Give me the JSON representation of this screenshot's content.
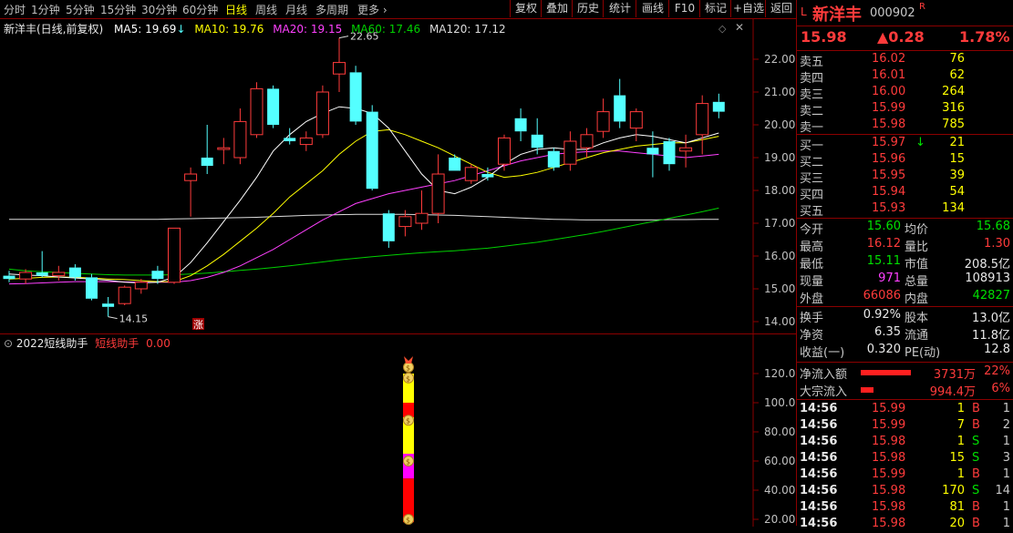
{
  "toolbar": {
    "periods": [
      "分时",
      "1分钟",
      "5分钟",
      "15分钟",
      "30分钟",
      "60分钟",
      "日线",
      "周线",
      "月线",
      "多周期",
      "更多"
    ],
    "active_period": "日线",
    "buttons": [
      "复权",
      "叠加",
      "历史",
      "统计",
      "画线",
      "F10",
      "标记",
      "+自选",
      "返回"
    ]
  },
  "chart_header": {
    "title": "新洋丰(日线,前复权)",
    "ma5": "MA5: 19.69",
    "ma10": "MA10: 19.76",
    "ma20": "MA20: 19.15",
    "ma60": "MA60: 17.46",
    "ma120": "MA120: 17.12"
  },
  "price_axis": [
    "22.00",
    "21.00",
    "20.00",
    "19.00",
    "18.00",
    "17.00",
    "16.00",
    "15.00",
    "14.00"
  ],
  "annotations": {
    "high": "22.65",
    "low": "14.15",
    "limit_up_mark": "涨"
  },
  "indicator": {
    "name": "2022短线助手",
    "label": "短线助手",
    "value": "0.00",
    "axis": [
      "120.00",
      "100.00",
      "80.00",
      "60.00",
      "40.00",
      "20.00"
    ]
  },
  "colors": {
    "up": "#ff3b3b",
    "down": "#54ffff",
    "ma5": "#ffffff",
    "ma10": "#ffff00",
    "ma20": "#ff40ff",
    "ma60": "#00d000",
    "ma120": "#dcdcdc"
  },
  "chart_data": {
    "type": "candlestick",
    "candles": [
      {
        "o": 15.4,
        "h": 15.55,
        "l": 15.2,
        "c": 15.3
      },
      {
        "o": 15.3,
        "h": 15.6,
        "l": 15.15,
        "c": 15.5
      },
      {
        "o": 15.5,
        "h": 16.15,
        "l": 15.35,
        "c": 15.4
      },
      {
        "o": 15.4,
        "h": 15.7,
        "l": 15.25,
        "c": 15.5
      },
      {
        "o": 15.65,
        "h": 15.75,
        "l": 15.25,
        "c": 15.35
      },
      {
        "o": 15.35,
        "h": 15.45,
        "l": 14.65,
        "c": 14.7
      },
      {
        "o": 14.55,
        "h": 14.75,
        "l": 14.15,
        "c": 14.45
      },
      {
        "o": 14.55,
        "h": 15.1,
        "l": 14.5,
        "c": 15.05
      },
      {
        "o": 15.0,
        "h": 15.3,
        "l": 14.85,
        "c": 15.2
      },
      {
        "o": 15.55,
        "h": 15.7,
        "l": 15.15,
        "c": 15.3
      },
      {
        "o": 15.2,
        "h": 16.85,
        "l": 15.15,
        "c": 16.85
      },
      {
        "o": 18.3,
        "h": 18.7,
        "l": 17.2,
        "c": 18.5
      },
      {
        "o": 19.0,
        "h": 20.0,
        "l": 18.5,
        "c": 18.75
      },
      {
        "o": 19.25,
        "h": 19.6,
        "l": 18.8,
        "c": 19.3
      },
      {
        "o": 19.0,
        "h": 20.5,
        "l": 18.8,
        "c": 20.1
      },
      {
        "o": 19.7,
        "h": 21.3,
        "l": 19.6,
        "c": 21.1
      },
      {
        "o": 21.1,
        "h": 21.2,
        "l": 19.9,
        "c": 20.0
      },
      {
        "o": 19.6,
        "h": 19.9,
        "l": 19.4,
        "c": 19.5
      },
      {
        "o": 19.4,
        "h": 19.8,
        "l": 19.2,
        "c": 19.6
      },
      {
        "o": 19.7,
        "h": 21.2,
        "l": 19.6,
        "c": 21.0
      },
      {
        "o": 21.55,
        "h": 22.65,
        "l": 21.0,
        "c": 21.9
      },
      {
        "o": 21.6,
        "h": 21.8,
        "l": 20.0,
        "c": 20.1
      },
      {
        "o": 20.4,
        "h": 20.6,
        "l": 18.0,
        "c": 18.05
      },
      {
        "o": 17.3,
        "h": 17.4,
        "l": 16.25,
        "c": 16.45
      },
      {
        "o": 16.9,
        "h": 17.4,
        "l": 16.6,
        "c": 17.2
      },
      {
        "o": 17.0,
        "h": 18.0,
        "l": 16.8,
        "c": 17.3
      },
      {
        "o": 17.3,
        "h": 19.1,
        "l": 17.0,
        "c": 18.5
      },
      {
        "o": 19.0,
        "h": 19.1,
        "l": 18.6,
        "c": 18.6
      },
      {
        "o": 18.3,
        "h": 18.8,
        "l": 18.2,
        "c": 18.7
      },
      {
        "o": 18.5,
        "h": 18.7,
        "l": 18.3,
        "c": 18.4
      },
      {
        "o": 18.8,
        "h": 19.7,
        "l": 18.6,
        "c": 19.6
      },
      {
        "o": 20.2,
        "h": 20.5,
        "l": 19.5,
        "c": 19.8
      },
      {
        "o": 19.7,
        "h": 20.2,
        "l": 19.1,
        "c": 19.3
      },
      {
        "o": 19.2,
        "h": 19.3,
        "l": 18.6,
        "c": 18.7
      },
      {
        "o": 18.8,
        "h": 19.8,
        "l": 18.6,
        "c": 19.5
      },
      {
        "o": 19.3,
        "h": 19.9,
        "l": 19.0,
        "c": 19.7
      },
      {
        "o": 19.8,
        "h": 20.8,
        "l": 19.6,
        "c": 20.4
      },
      {
        "o": 20.9,
        "h": 21.4,
        "l": 19.9,
        "c": 20.1
      },
      {
        "o": 19.9,
        "h": 20.5,
        "l": 19.5,
        "c": 20.4
      },
      {
        "o": 19.3,
        "h": 19.8,
        "l": 18.4,
        "c": 19.1
      },
      {
        "o": 19.5,
        "h": 19.6,
        "l": 18.6,
        "c": 18.8
      },
      {
        "o": 19.2,
        "h": 19.7,
        "l": 18.7,
        "c": 19.3
      },
      {
        "o": 19.7,
        "h": 20.9,
        "l": 19.1,
        "c": 20.65
      },
      {
        "o": 20.7,
        "h": 20.95,
        "l": 20.2,
        "c": 20.4
      }
    ],
    "ylim": [
      13.75,
      23.1
    ],
    "ma": {
      "ma5": [
        15.45,
        15.42,
        15.4,
        15.36,
        15.33,
        15.3,
        15.26,
        15.2,
        15.18,
        15.2,
        15.35,
        15.8,
        16.4,
        17.05,
        17.7,
        18.4,
        19.2,
        19.7,
        20.1,
        20.35,
        20.55,
        20.5,
        20.35,
        19.9,
        19.2,
        18.5,
        18.0,
        17.9,
        18.1,
        18.4,
        18.8,
        19.1,
        19.25,
        19.3,
        19.25,
        19.25,
        19.45,
        19.6,
        19.7,
        19.65,
        19.55,
        19.45,
        19.6,
        19.75
      ],
      "ma10": [
        15.3,
        15.32,
        15.35,
        15.36,
        15.35,
        15.33,
        15.3,
        15.28,
        15.25,
        15.22,
        15.22,
        15.4,
        15.7,
        16.05,
        16.45,
        16.85,
        17.3,
        17.8,
        18.2,
        18.6,
        19.1,
        19.5,
        19.8,
        19.85,
        19.7,
        19.5,
        19.3,
        19.05,
        18.8,
        18.55,
        18.4,
        18.45,
        18.55,
        18.7,
        18.85,
        19.0,
        19.15,
        19.25,
        19.35,
        19.4,
        19.45,
        19.45,
        19.55,
        19.65
      ],
      "ma20": [
        15.15,
        15.16,
        15.18,
        15.2,
        15.22,
        15.22,
        15.22,
        15.21,
        15.2,
        15.2,
        15.2,
        15.25,
        15.35,
        15.5,
        15.7,
        15.95,
        16.2,
        16.5,
        16.8,
        17.1,
        17.35,
        17.6,
        17.75,
        17.9,
        18.0,
        18.1,
        18.2,
        18.3,
        18.45,
        18.6,
        18.75,
        18.9,
        19.0,
        19.1,
        19.15,
        19.18,
        19.2,
        19.2,
        19.15,
        19.1,
        19.05,
        19.0,
        19.05,
        19.1
      ],
      "ma60": [
        15.6,
        15.55,
        15.52,
        15.5,
        15.47,
        15.45,
        15.43,
        15.42,
        15.42,
        15.42,
        15.43,
        15.45,
        15.48,
        15.52,
        15.56,
        15.6,
        15.65,
        15.7,
        15.76,
        15.82,
        15.88,
        15.93,
        15.98,
        16.02,
        16.06,
        16.1,
        16.13,
        16.16,
        16.2,
        16.24,
        16.3,
        16.36,
        16.42,
        16.5,
        16.58,
        16.66,
        16.75,
        16.85,
        16.95,
        17.05,
        17.15,
        17.25,
        17.35,
        17.46
      ],
      "ma120": [
        17.12,
        17.12,
        17.12,
        17.12,
        17.12,
        17.12,
        17.12,
        17.12,
        17.12,
        17.12,
        17.13,
        17.14,
        17.15,
        17.16,
        17.17,
        17.18,
        17.2,
        17.22,
        17.24,
        17.25,
        17.26,
        17.27,
        17.27,
        17.27,
        17.27,
        17.26,
        17.25,
        17.24,
        17.22,
        17.2,
        17.18,
        17.16,
        17.14,
        17.12,
        17.11,
        17.1,
        17.1,
        17.1,
        17.1,
        17.1,
        17.11,
        17.11,
        17.12,
        17.12
      ]
    },
    "indicator_segments": [
      {
        "from": 120,
        "to": 100,
        "color": "#ffff00"
      },
      {
        "from": 100,
        "to": 90,
        "color": "#ff0000"
      },
      {
        "from": 90,
        "to": 65,
        "color": "#ffff00"
      },
      {
        "from": 65,
        "to": 48,
        "color": "#ff00ff"
      },
      {
        "from": 48,
        "to": 18,
        "color": "#ff0000"
      }
    ],
    "indicator_ylim": [
      18,
      130
    ]
  },
  "quote": {
    "code_prefix": "L",
    "name": "新洋丰",
    "code": "000902",
    "flag": "R",
    "price": "15.98",
    "change": "▲0.28",
    "change_pct": "1.78%",
    "asks": [
      {
        "label": "卖五",
        "price": "16.02",
        "vol": "76"
      },
      {
        "label": "卖四",
        "price": "16.01",
        "vol": "62"
      },
      {
        "label": "卖三",
        "price": "16.00",
        "vol": "264"
      },
      {
        "label": "卖二",
        "price": "15.99",
        "vol": "316"
      },
      {
        "label": "卖一",
        "price": "15.98",
        "vol": "785"
      }
    ],
    "bids": [
      {
        "label": "买一",
        "price": "15.97",
        "vol": "21",
        "arrow": "↓"
      },
      {
        "label": "买二",
        "price": "15.96",
        "vol": "15",
        "arrow": ""
      },
      {
        "label": "买三",
        "price": "15.95",
        "vol": "39",
        "arrow": ""
      },
      {
        "label": "买四",
        "price": "15.94",
        "vol": "54",
        "arrow": ""
      },
      {
        "label": "买五",
        "price": "15.93",
        "vol": "134",
        "arrow": ""
      }
    ],
    "stats": [
      {
        "l1": "今开",
        "v1": "15.60",
        "c1": "c-grn",
        "l2": "均价",
        "v2": "15.68",
        "c2": "c-grn"
      },
      {
        "l1": "最高",
        "v1": "16.12",
        "c1": "c-red",
        "l2": "量比",
        "v2": "1.30",
        "c2": "c-red"
      },
      {
        "l1": "最低",
        "v1": "15.11",
        "c1": "c-grn",
        "l2": "市值",
        "v2": "208.5亿",
        "c2": "c-wht"
      },
      {
        "l1": "现量",
        "v1": "971",
        "c1": "c-mag",
        "l2": "总量",
        "v2": "108913",
        "c2": "c-wht"
      },
      {
        "l1": "外盘",
        "v1": "66086",
        "c1": "c-red",
        "l2": "内盘",
        "v2": "42827",
        "c2": "c-grn"
      }
    ],
    "fin": [
      {
        "l1": "换手",
        "v1": "0.92%",
        "l2": "股本",
        "v2": "13.0亿"
      },
      {
        "l1": "净资",
        "v1": "6.35",
        "l2": "流通",
        "v2": "11.8亿"
      },
      {
        "l1": "收益(一)",
        "v1": "0.320",
        "l2": "PE(动)",
        "v2": "12.8"
      }
    ],
    "flows": [
      {
        "label": "净流入额",
        "value": "3731万",
        "pct": "22%",
        "bar": 0.7
      },
      {
        "label": "大宗流入",
        "value": "994.4万",
        "pct": "6%",
        "bar": 0.18
      }
    ],
    "ticks": [
      {
        "time": "14:56",
        "price": "15.99",
        "vol": "1",
        "bs": "B",
        "n": "1"
      },
      {
        "time": "14:56",
        "price": "15.99",
        "vol": "7",
        "bs": "B",
        "n": "2"
      },
      {
        "time": "14:56",
        "price": "15.98",
        "vol": "1",
        "bs": "S",
        "n": "1"
      },
      {
        "time": "14:56",
        "price": "15.98",
        "vol": "15",
        "bs": "S",
        "n": "3"
      },
      {
        "time": "14:56",
        "price": "15.99",
        "vol": "1",
        "bs": "B",
        "n": "1"
      },
      {
        "time": "14:56",
        "price": "15.98",
        "vol": "170",
        "bs": "S",
        "n": "14"
      },
      {
        "time": "14:56",
        "price": "15.98",
        "vol": "81",
        "bs": "B",
        "n": "1"
      },
      {
        "time": "14:56",
        "price": "15.98",
        "vol": "20",
        "bs": "B",
        "n": "1"
      }
    ]
  }
}
